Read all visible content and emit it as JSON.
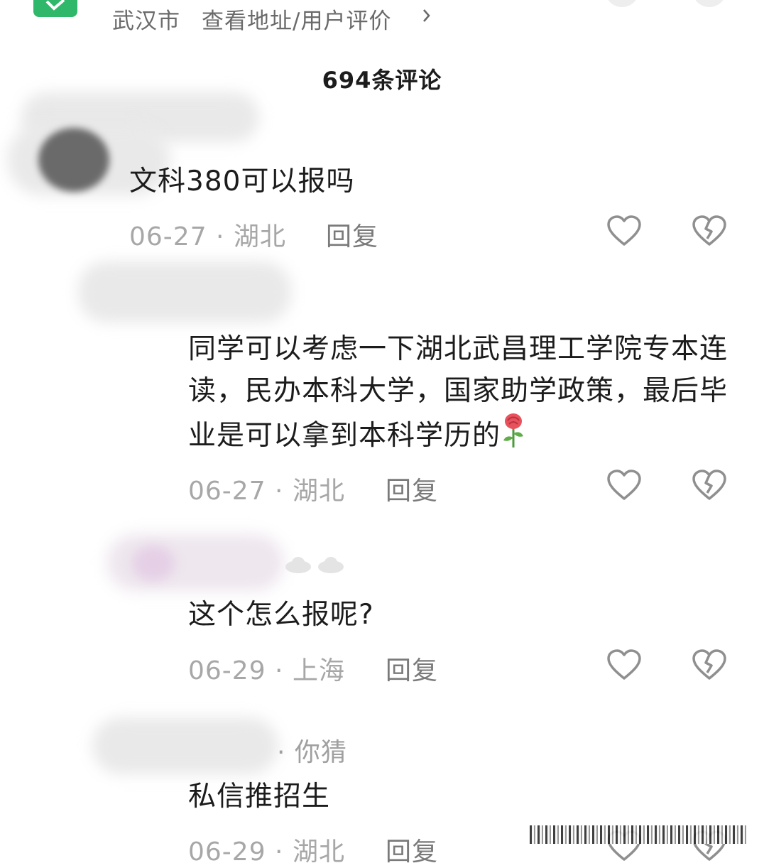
{
  "header": {
    "city": "武汉市",
    "address_link": "查看地址/用户评价"
  },
  "comment_count": "694条评论",
  "comments": [
    {
      "text": "文科380可以报吗",
      "date": "06-27",
      "region": "湖北",
      "reply": "回复"
    },
    {
      "text": "同学可以考虑一下湖北武昌理工学院专本连读，民办本科大学，国家助学政策，最后毕业是可以拿到本科学历的",
      "date": "06-27",
      "region": "湖北",
      "reply": "回复"
    },
    {
      "text": "这个怎么报呢?",
      "date": "06-29",
      "region": "上海",
      "reply": "回复"
    },
    {
      "nickname_suffix": "你猜",
      "text": "私信推招生",
      "date": "06-29",
      "region": "湖北",
      "reply": "回复"
    }
  ],
  "colors": {
    "badge_green": "#2fb86a",
    "text_primary": "#1c1c1c",
    "text_meta": "#a7a7a7",
    "reply_gray": "#7a7a7a",
    "icon_gray": "#8f8f8f"
  },
  "icons": {
    "like": "heart-outline-icon",
    "dislike": "broken-heart-icon",
    "emoji": "rose-icon"
  }
}
